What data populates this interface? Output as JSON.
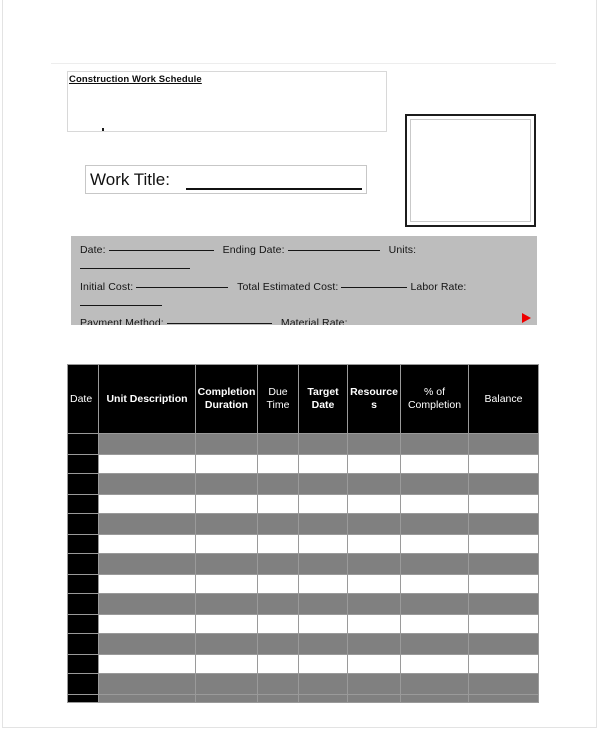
{
  "document": {
    "title": "Construction Work Schedule",
    "work_title_label": "Work Title:"
  },
  "info_panel": {
    "background_color": "#bdbdbd",
    "line1_date_label": "Date:",
    "line1_ending_date_label": "Ending Date:",
    "line1_units_label": "Units:",
    "line2_initial_cost_label": "Initial Cost:",
    "line2_total_estimated_cost_label": "Total Estimated Cost:",
    "line2_labor_rate_label": "Labor Rate:",
    "line3_payment_method_label": "Payment Method:",
    "line3_material_rate_label": "Material Rate:"
  },
  "marker": {
    "color": "#ee0000",
    "name": "red-triangle"
  },
  "table": {
    "columns": [
      {
        "label": "Date",
        "bold": false
      },
      {
        "label": "Unit Description",
        "bold": true
      },
      {
        "label": "Completion Duration",
        "bold": true
      },
      {
        "label": "Due Time",
        "bold": false
      },
      {
        "label": "Target Date",
        "bold": true
      },
      {
        "label": "Resources",
        "bold": true
      },
      {
        "label": "% of Completion",
        "bold": false
      },
      {
        "label": "Balance",
        "bold": false
      }
    ],
    "row_count": 14,
    "header_background": "#000000",
    "header_text_color": "#ffffff",
    "stripe_gray": "#808080",
    "stripe_white": "#ffffff",
    "date_column_fill": "#000000"
  }
}
